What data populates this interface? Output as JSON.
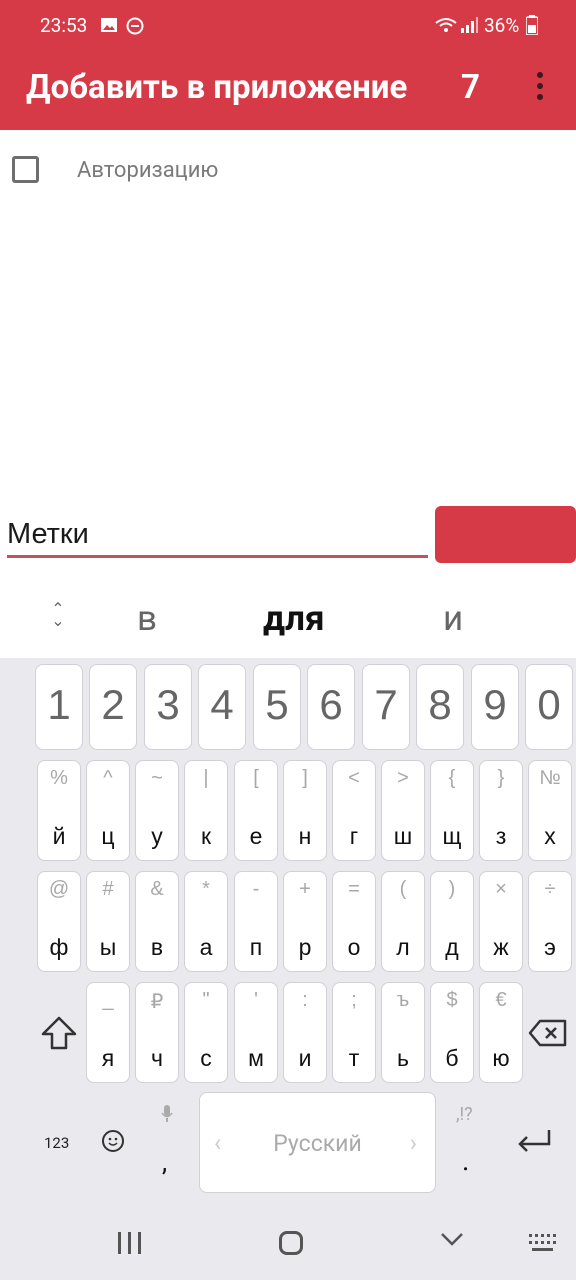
{
  "status_bar": {
    "time": "23:53",
    "battery": "36%",
    "icons": [
      "gallery-icon",
      "dnd-icon",
      "wifi-icon",
      "signal-icon",
      "battery-icon"
    ]
  },
  "app_bar": {
    "title": "Добавить в приложение",
    "count": "7",
    "menu_icon": "more-vert-icon",
    "color": "#d63a47"
  },
  "list": {
    "items": [
      {
        "label": "Авторизацию",
        "checked": false
      }
    ]
  },
  "input": {
    "value": "Метки"
  },
  "add_button": {
    "color": "#d63a47"
  },
  "suggestions": {
    "expand_icon": "expand-vertical-icon",
    "items": [
      "в",
      "для",
      "и"
    ]
  },
  "keyboard": {
    "numbers": [
      "1",
      "2",
      "3",
      "4",
      "5",
      "6",
      "7",
      "8",
      "9",
      "0"
    ],
    "row1": [
      {
        "main": "й",
        "sym": "%"
      },
      {
        "main": "ц",
        "sym": "^"
      },
      {
        "main": "у",
        "sym": "~"
      },
      {
        "main": "к",
        "sym": "|"
      },
      {
        "main": "е",
        "sym": "["
      },
      {
        "main": "н",
        "sym": "]"
      },
      {
        "main": "г",
        "sym": "<"
      },
      {
        "main": "ш",
        "sym": ">"
      },
      {
        "main": "щ",
        "sym": "{"
      },
      {
        "main": "з",
        "sym": "}"
      },
      {
        "main": "х",
        "sym": "№"
      }
    ],
    "row2": [
      {
        "main": "ф",
        "sym": "@"
      },
      {
        "main": "ы",
        "sym": "#"
      },
      {
        "main": "в",
        "sym": "&"
      },
      {
        "main": "а",
        "sym": "*"
      },
      {
        "main": "п",
        "sym": "-"
      },
      {
        "main": "р",
        "sym": "+"
      },
      {
        "main": "о",
        "sym": "="
      },
      {
        "main": "л",
        "sym": "("
      },
      {
        "main": "д",
        "sym": ")"
      },
      {
        "main": "ж",
        "sym": "×"
      },
      {
        "main": "э",
        "sym": "÷"
      }
    ],
    "row3": [
      {
        "main": "я",
        "sym": "_"
      },
      {
        "main": "ч",
        "sym": "₽"
      },
      {
        "main": "с",
        "sym": "\""
      },
      {
        "main": "м",
        "sym": "'"
      },
      {
        "main": "и",
        "sym": ":"
      },
      {
        "main": "т",
        "sym": ";"
      },
      {
        "main": "ь",
        "sym": "ъ"
      },
      {
        "main": "б",
        "sym": "$"
      },
      {
        "main": "ю",
        "sym": "€"
      }
    ],
    "shift_icon": "shift-icon",
    "backspace_icon": "backspace-icon",
    "symbols_label": "123",
    "emoji_icon": "emoji-icon",
    "mic_icon": "mic-icon",
    "comma": ",",
    "space_label": "Русский",
    "punct_hint": ",!?",
    "period": ".",
    "enter_icon": "enter-icon"
  },
  "nav_bar": {
    "icons": [
      "recents-icon",
      "home-icon",
      "back-icon",
      "keyboard-icon"
    ]
  }
}
